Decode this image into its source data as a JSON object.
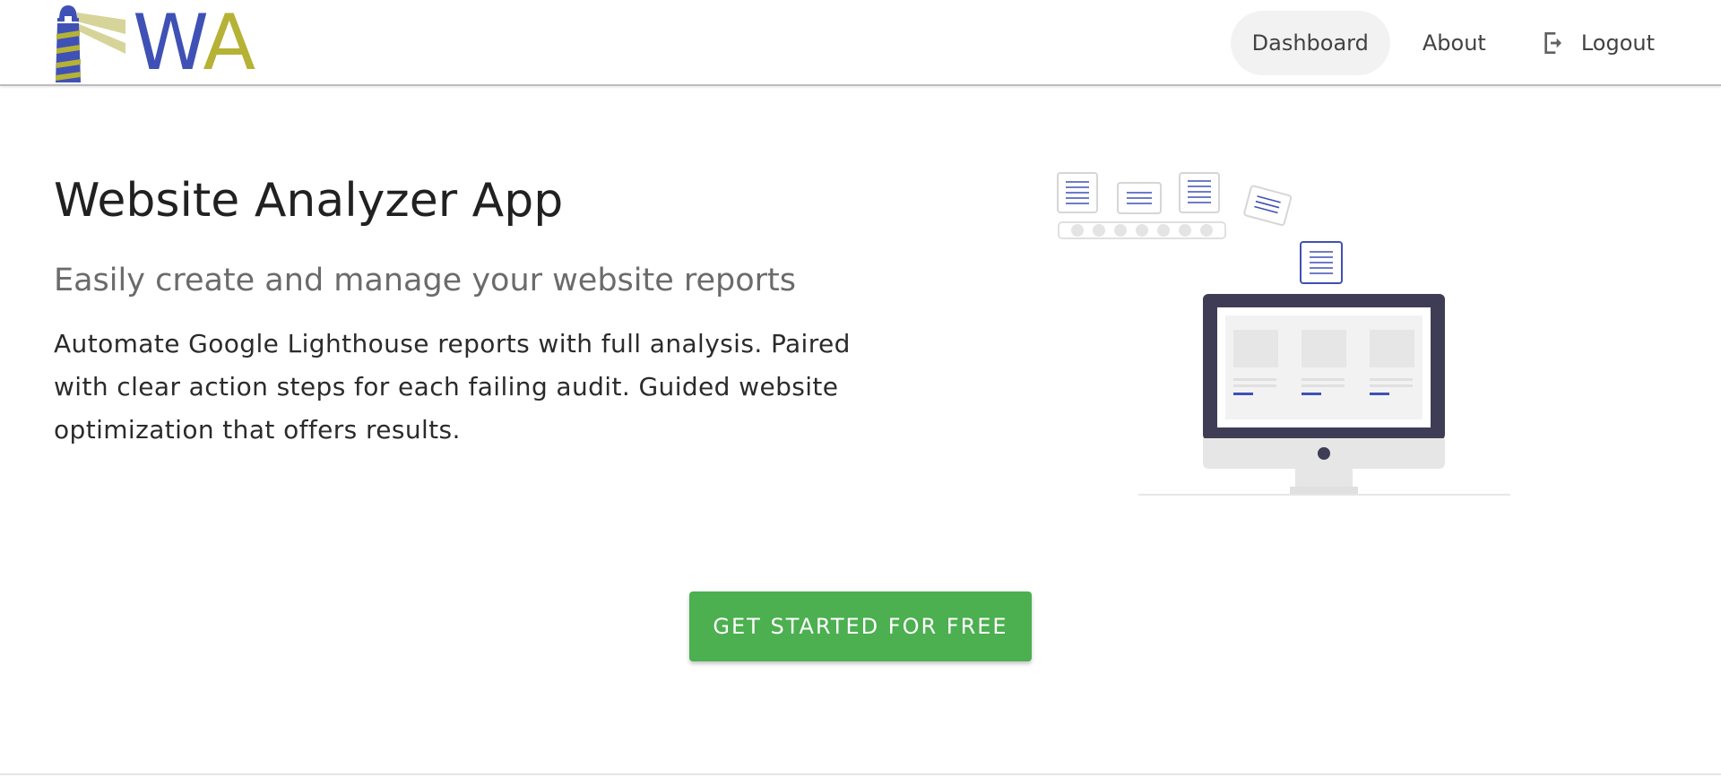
{
  "app": {
    "logo": {
      "letter_w": "W",
      "letter_a": "A",
      "icon": "lighthouse-icon",
      "colors": {
        "blue": "#3f51b5",
        "gold": "#b5b236"
      }
    }
  },
  "nav": {
    "items": [
      {
        "label": "Dashboard",
        "active": true
      },
      {
        "label": "About",
        "active": false
      },
      {
        "label": "Logout",
        "active": false,
        "icon": "logout-icon"
      }
    ]
  },
  "hero": {
    "title": "Website Analyzer App",
    "subtitle": "Easily create and manage your website reports",
    "description": "Automate Google Lighthouse reports with full analysis. Paired with clear action steps for each failing audit. Guided website optimization that offers results.",
    "illustration": "reports-monitor-illustration"
  },
  "cta": {
    "label": "GET STARTED FOR FREE",
    "color": "#4caf50"
  }
}
